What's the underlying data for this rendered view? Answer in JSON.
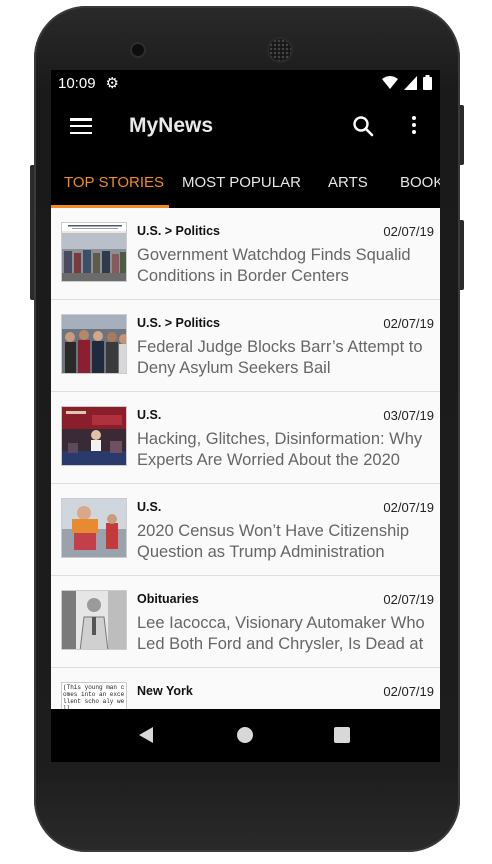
{
  "status_bar": {
    "time": "10:09"
  },
  "toolbar": {
    "title": "MyNews"
  },
  "tabs": [
    {
      "label": "TOP STORIES",
      "active": true
    },
    {
      "label": "MOST POPULAR",
      "active": false
    },
    {
      "label": "ARTS",
      "active": false
    },
    {
      "label": "BOOK",
      "active": false
    }
  ],
  "articles": [
    {
      "section": "U.S. > Politics",
      "date": "02/07/19",
      "headline": "Government Watchdog Finds Squalid Conditions in Border Centers",
      "thumb_text": ""
    },
    {
      "section": "U.S. > Politics",
      "date": "02/07/19",
      "headline": "Federal Judge Blocks Barr’s Attempt to Deny Asylum Seekers Bail",
      "thumb_text": ""
    },
    {
      "section": "U.S.",
      "date": "03/07/19",
      "headline": "Hacking, Glitches, Disinformation: Why Experts Are Worried About the 2020",
      "thumb_text": ""
    },
    {
      "section": "U.S.",
      "date": "02/07/19",
      "headline": "2020 Census Won’t Have Citizenship Question as Trump Administration",
      "thumb_text": ""
    },
    {
      "section": "Obituaries",
      "date": "02/07/19",
      "headline": "Lee Iacocca, Visionary Automaker Who Led Both Ford and Chrysler, Is Dead at",
      "thumb_text": ""
    },
    {
      "section": "New York",
      "date": "02/07/19",
      "headline": "",
      "thumb_text": "(This young man comes into an excellent scho aly well."
    }
  ],
  "colors": {
    "accent": "#f08a24",
    "bar": "#000000",
    "headline": "#666666"
  }
}
